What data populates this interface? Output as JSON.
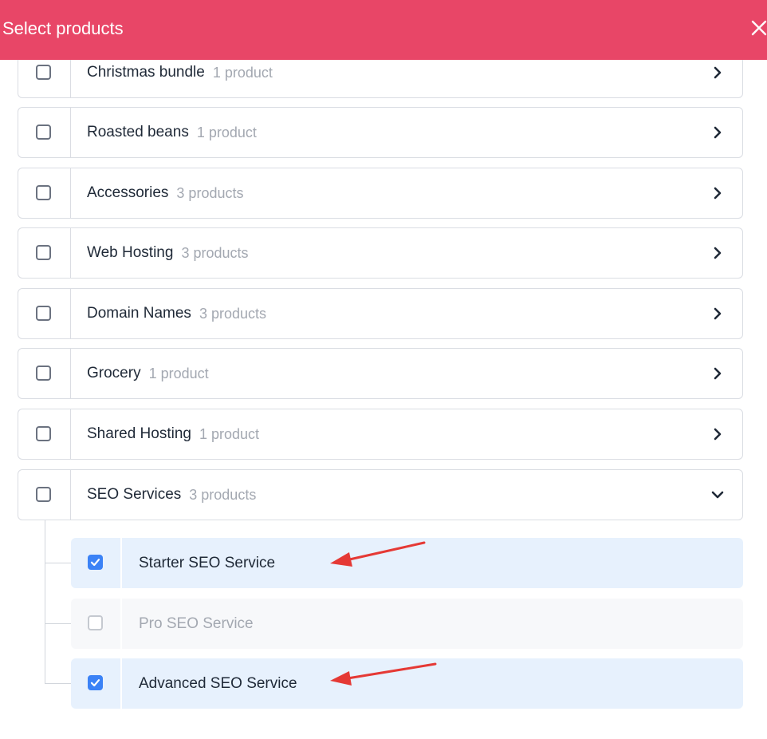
{
  "modal": {
    "title": "Select products",
    "close_icon": "close-icon"
  },
  "categories": [
    {
      "name": "Christmas bundle",
      "count": "1 product",
      "expanded": false,
      "checked": false
    },
    {
      "name": "Roasted beans",
      "count": "1 product",
      "expanded": false,
      "checked": false
    },
    {
      "name": "Accessories",
      "count": "3 products",
      "expanded": false,
      "checked": false
    },
    {
      "name": "Web Hosting",
      "count": "3 products",
      "expanded": false,
      "checked": false
    },
    {
      "name": "Domain Names",
      "count": "3 products",
      "expanded": false,
      "checked": false
    },
    {
      "name": "Grocery",
      "count": "1 product",
      "expanded": false,
      "checked": false
    },
    {
      "name": "Shared Hosting",
      "count": "1 product",
      "expanded": false,
      "checked": false
    },
    {
      "name": "SEO Services",
      "count": "3 products",
      "expanded": true,
      "checked": false
    }
  ],
  "seo_products": [
    {
      "name": "Starter SEO Service",
      "checked": true,
      "disabled": false
    },
    {
      "name": "Pro SEO Service",
      "checked": false,
      "disabled": true
    },
    {
      "name": "Advanced SEO Service",
      "checked": true,
      "disabled": false
    }
  ],
  "colors": {
    "header": "#e84667",
    "checkbox_checked": "#3b82f6",
    "selected_row": "#e7f1fd",
    "annotation_arrow": "#e53935"
  },
  "icons": {
    "collapsed": "chevron-right-icon",
    "expanded": "chevron-down-icon",
    "check": "checkmark-icon"
  }
}
